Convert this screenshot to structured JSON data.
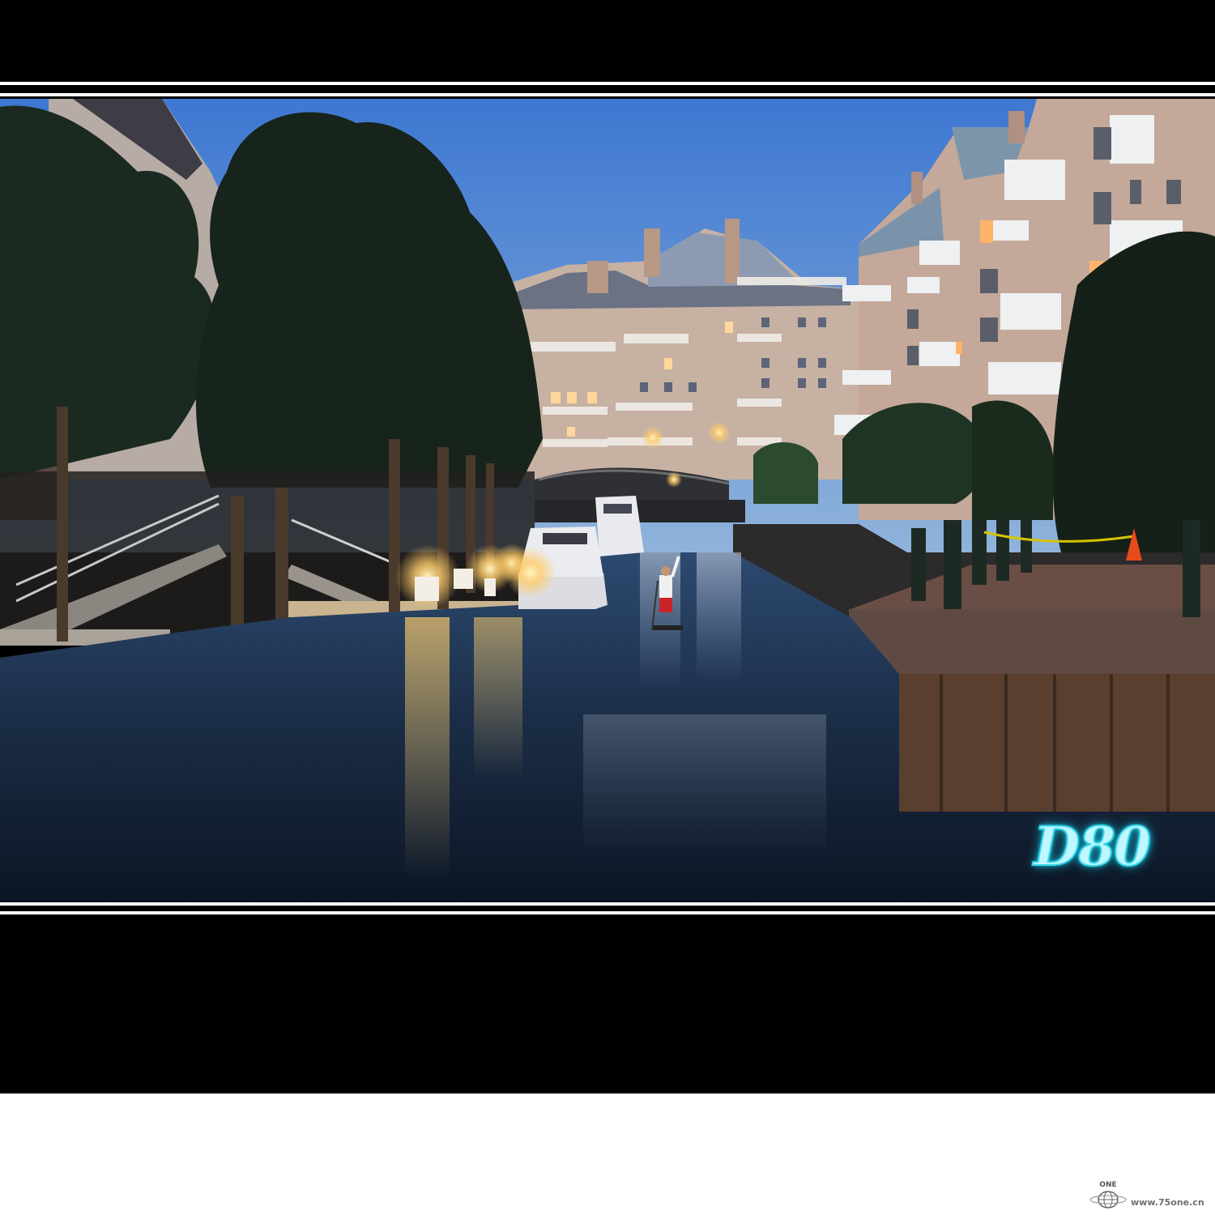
{
  "photo": {
    "subject": "canal-at-dusk",
    "colors": {
      "sky_top": "#3d77d1",
      "sky_bottom": "#8fb3da",
      "water": "#1a2c45",
      "lamp_glow": "#ffcc6a",
      "frame": "#000000"
    }
  },
  "watermark": {
    "text": "D80"
  },
  "site": {
    "logo_text": "ONE",
    "url": "www.75one.cn"
  }
}
